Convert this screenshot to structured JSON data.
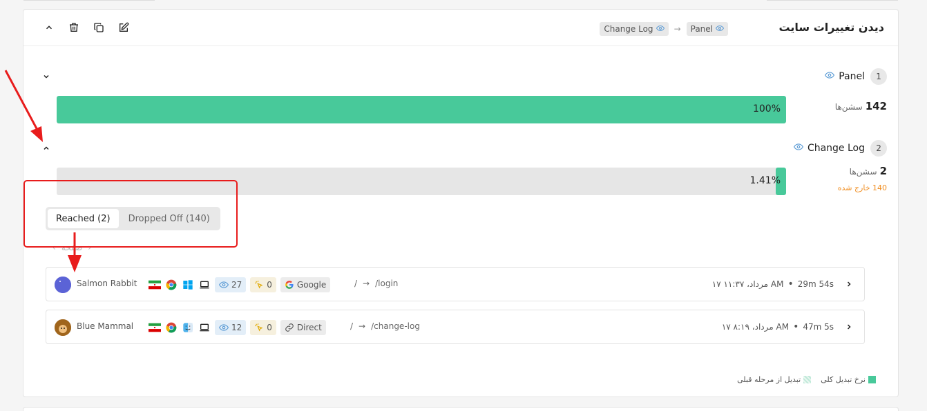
{
  "header": {
    "title": "دیدن تغییرات سایت",
    "breadcrumb": [
      "Change Log",
      "Panel"
    ]
  },
  "steps": [
    {
      "num": "1",
      "label": "Panel",
      "count": "142",
      "unit": "سشن‌ها",
      "percent": "100%",
      "fill": 1.0
    },
    {
      "num": "2",
      "label": "Change Log",
      "count": "2",
      "unit": "سشن‌ها",
      "percent": "1.41%",
      "fill": 0.0141,
      "dropped": "140 خارج شده"
    }
  ],
  "tabs": {
    "reached": "Reached (2)",
    "dropped": "Dropped Off (140)"
  },
  "pager": {
    "label": "صفحه"
  },
  "sessions": [
    {
      "name": "Salmon Rabbit",
      "os": "windows",
      "views": "27",
      "clicks": "0",
      "source": "Google",
      "path_from": "/",
      "path_to": "/login",
      "time": "AM مرداد، ۱۱:۳۷ ۱۷",
      "duration": "29m 54s",
      "avatar_color": "#6a5acd"
    },
    {
      "name": "Blue Mammal",
      "os": "mac",
      "views": "12",
      "clicks": "0",
      "source": "Direct",
      "path_from": "/",
      "path_to": "/change-log",
      "time": "AM مرداد، ۸:۱۹ ۱۷",
      "duration": "47m 5s",
      "avatar_color": "#a0651c"
    }
  ],
  "legend": {
    "overall": "نرخ تبدیل کلی",
    "step": "تبدیل از مرحله قبلی"
  }
}
